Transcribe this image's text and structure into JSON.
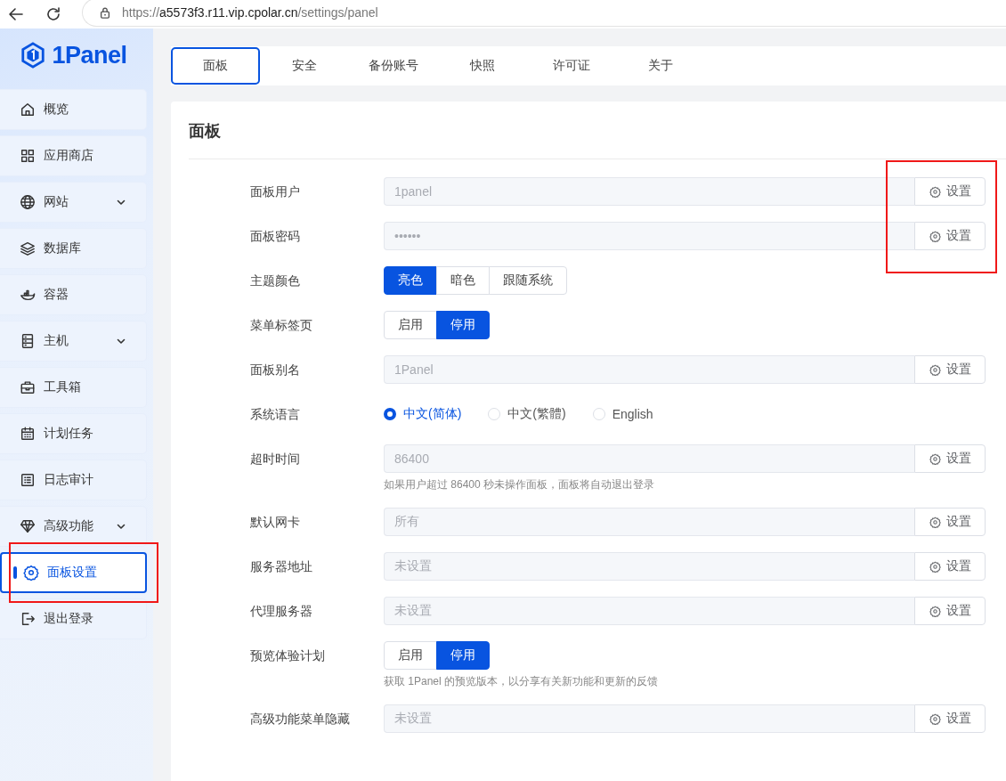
{
  "browser": {
    "url": {
      "scheme": "https://",
      "host": "a5573f3.r11.vip.cpolar.cn",
      "path": "/settings/panel"
    }
  },
  "sidebar": {
    "logo_text": "1Panel",
    "items": [
      {
        "label": "概览",
        "expandable": false,
        "selected": false,
        "highlighted": false
      },
      {
        "label": "应用商店",
        "expandable": false,
        "selected": false,
        "highlighted": false
      },
      {
        "label": "网站",
        "expandable": true,
        "selected": false,
        "highlighted": false
      },
      {
        "label": "数据库",
        "expandable": false,
        "selected": false,
        "highlighted": false
      },
      {
        "label": "容器",
        "expandable": false,
        "selected": false,
        "highlighted": false
      },
      {
        "label": "主机",
        "expandable": true,
        "selected": false,
        "highlighted": false
      },
      {
        "label": "工具箱",
        "expandable": false,
        "selected": false,
        "highlighted": false
      },
      {
        "label": "计划任务",
        "expandable": false,
        "selected": false,
        "highlighted": false
      },
      {
        "label": "日志审计",
        "expandable": false,
        "selected": false,
        "highlighted": false
      },
      {
        "label": "高级功能",
        "expandable": true,
        "selected": false,
        "highlighted": false
      },
      {
        "label": "面板设置",
        "expandable": false,
        "selected": true,
        "highlighted": true
      },
      {
        "label": "退出登录",
        "expandable": false,
        "selected": false,
        "highlighted": false
      }
    ]
  },
  "tabs": [
    {
      "label": "面板",
      "selected": true
    },
    {
      "label": "安全",
      "selected": false
    },
    {
      "label": "备份账号",
      "selected": false
    },
    {
      "label": "快照",
      "selected": false
    },
    {
      "label": "许可证",
      "selected": false
    },
    {
      "label": "关于",
      "selected": false
    }
  ],
  "card": {
    "title": "面板",
    "rows": [
      {
        "kind": "input",
        "label": "面板用户",
        "value": "1panel",
        "button": "设置",
        "highlighted": true
      },
      {
        "kind": "input",
        "label": "面板密码",
        "value": "••••••",
        "button": "设置",
        "highlighted": true
      },
      {
        "kind": "segmented",
        "label": "主题颜色",
        "options": [
          {
            "label": "亮色",
            "selected": true
          },
          {
            "label": "暗色",
            "selected": false
          },
          {
            "label": "跟随系统",
            "selected": false
          }
        ]
      },
      {
        "kind": "segmented",
        "label": "菜单标签页",
        "options": [
          {
            "label": "启用",
            "selected": false
          },
          {
            "label": "停用",
            "selected": true
          }
        ]
      },
      {
        "kind": "input",
        "label": "面板别名",
        "value": "1Panel",
        "button": "设置",
        "highlighted": false
      },
      {
        "kind": "radio",
        "label": "系统语言",
        "options": [
          {
            "label": "中文(简体)",
            "selected": true
          },
          {
            "label": "中文(繁體)",
            "selected": false
          },
          {
            "label": "English",
            "selected": false
          }
        ]
      },
      {
        "kind": "input",
        "label": "超时时间",
        "value": "86400",
        "button": "设置",
        "highlighted": false,
        "hint": "如果用户超过 86400 秒未操作面板，面板将自动退出登录"
      },
      {
        "kind": "input",
        "label": "默认网卡",
        "value": "所有",
        "button": "设置",
        "highlighted": false
      },
      {
        "kind": "input",
        "label": "服务器地址",
        "value": "未设置",
        "button": "设置",
        "highlighted": false
      },
      {
        "kind": "input",
        "label": "代理服务器",
        "value": "未设置",
        "button": "设置",
        "highlighted": false
      },
      {
        "kind": "segmented",
        "label": "预览体验计划",
        "options": [
          {
            "label": "启用",
            "selected": false
          },
          {
            "label": "停用",
            "selected": true
          }
        ],
        "hint": "获取 1Panel 的预览版本，以分享有关新功能和更新的反馈"
      },
      {
        "kind": "input",
        "label": "高级功能菜单隐藏",
        "value": "未设置",
        "button": "设置",
        "highlighted": false
      }
    ]
  }
}
